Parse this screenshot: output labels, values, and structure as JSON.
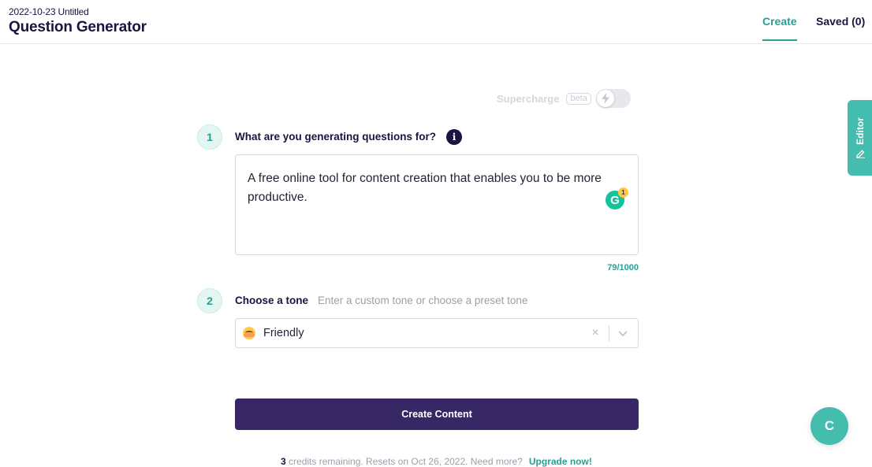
{
  "header": {
    "subtitle": "2022-10-23 Untitled",
    "title": "Question Generator",
    "tabs": [
      {
        "label": "Create",
        "active": true
      },
      {
        "label": "Saved (0)",
        "active": false
      }
    ]
  },
  "supercharge": {
    "label": "Supercharge",
    "badge": "beta",
    "enabled": false,
    "icon": "lightning-icon"
  },
  "step1": {
    "number": "1",
    "label": "What are you generating questions for?",
    "info_icon": "i",
    "input_value": "A free online tool for content creation that enables you to be more productive.",
    "char_count": "79/1000",
    "grammarly_icon": "G",
    "grammarly_badge": "1"
  },
  "step2": {
    "number": "2",
    "label": "Choose a tone",
    "hint": "Enter a custom tone or choose a preset tone",
    "selected_value": "Friendly",
    "selected_icon": "smiling-face-emoji",
    "clear_icon": "×"
  },
  "actions": {
    "create_label": "Create Content"
  },
  "footer": {
    "credits_count": "3",
    "credits_text": " credits remaining. Resets on Oct 26, 2022. Need more?",
    "upgrade_label": "Upgrade now!"
  },
  "side": {
    "editor_label": "Editor",
    "chat_label": "C"
  },
  "colors": {
    "accent": "#27a093",
    "primary": "#372865",
    "text_dark": "#1a1440",
    "teal_light": "#44bcae"
  }
}
